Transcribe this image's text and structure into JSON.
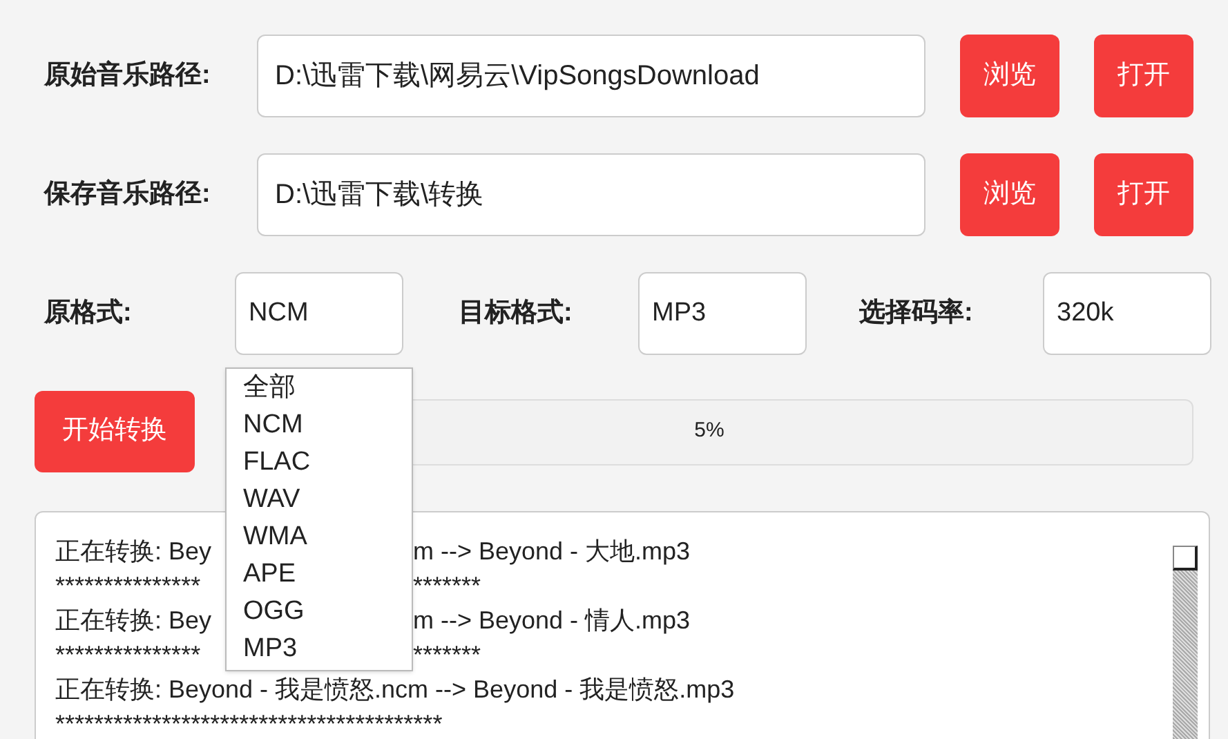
{
  "paths": [
    {
      "label": "原始音乐路径:",
      "value": "D:\\迅雷下载\\网易云\\VipSongsDownload",
      "buttons": [
        "浏览",
        "打开"
      ]
    },
    {
      "label": "保存音乐路径:",
      "value": "D:\\迅雷下载\\转换",
      "buttons": [
        "浏览",
        "打开"
      ]
    }
  ],
  "formats": [
    {
      "label": "原格式:",
      "value": "NCM"
    },
    {
      "label": "目标格式:",
      "value": "MP3"
    },
    {
      "label": "选择码率:",
      "value": "320k"
    }
  ],
  "start_button": "开始转换",
  "progress": {
    "reading": "5%"
  },
  "dropdown": {
    "options": [
      "全部",
      "NCM",
      "FLAC",
      "WAV",
      "WMA",
      "APE",
      "OGG",
      "MP3"
    ]
  },
  "log": [
    {
      "kind": "split",
      "left": "正在转换: Bey",
      "right": "m --> Beyond - 大地.mp3"
    },
    {
      "kind": "split",
      "left": "***************",
      "right": "*******"
    },
    {
      "kind": "split",
      "left": "正在转换: Bey",
      "right": "m --> Beyond - 情人.mp3"
    },
    {
      "kind": "split",
      "left": "***************",
      "right": "*******"
    },
    {
      "kind": "full",
      "text": "正在转换: Beyond - 我是愤怒.ncm --> Beyond - 我是愤怒.mp3"
    },
    {
      "kind": "full",
      "text": "****************************************"
    }
  ]
}
